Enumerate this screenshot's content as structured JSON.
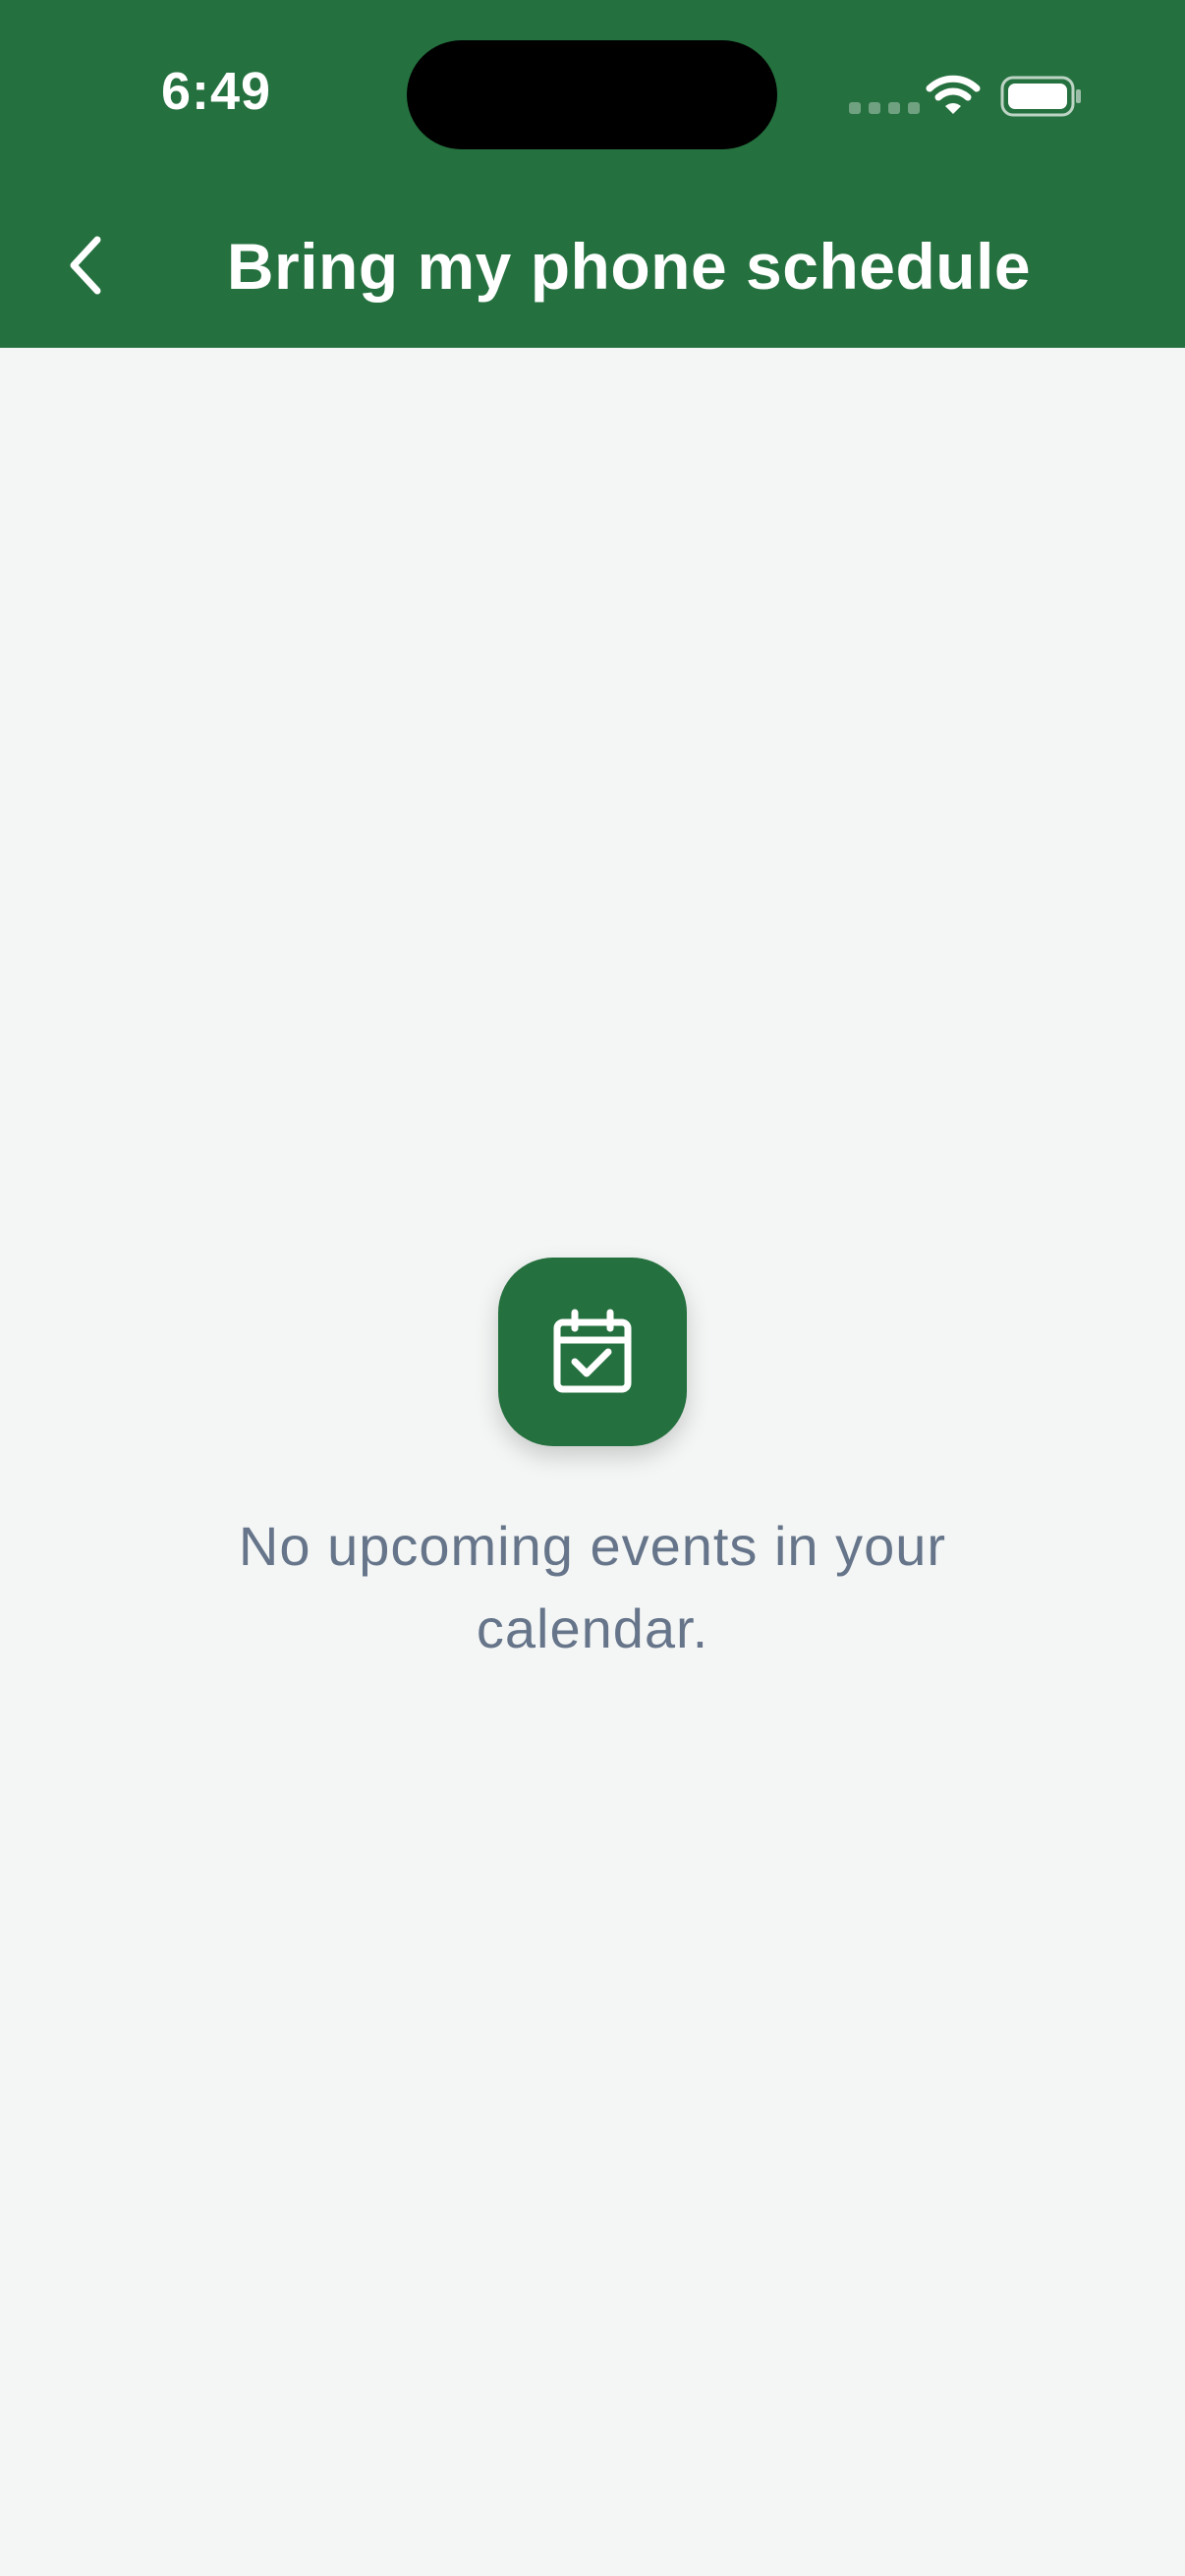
{
  "status_bar": {
    "time": "6:49"
  },
  "header": {
    "title": "Bring my phone schedule",
    "back_icon": "chevron-left-icon"
  },
  "empty_state": {
    "icon": "calendar-check-icon",
    "message": "No upcoming events in your calendar."
  },
  "colors": {
    "primary": "#24703e",
    "background": "#f4f6f5",
    "message_text": "#66758a",
    "header_text": "#ffffff"
  }
}
